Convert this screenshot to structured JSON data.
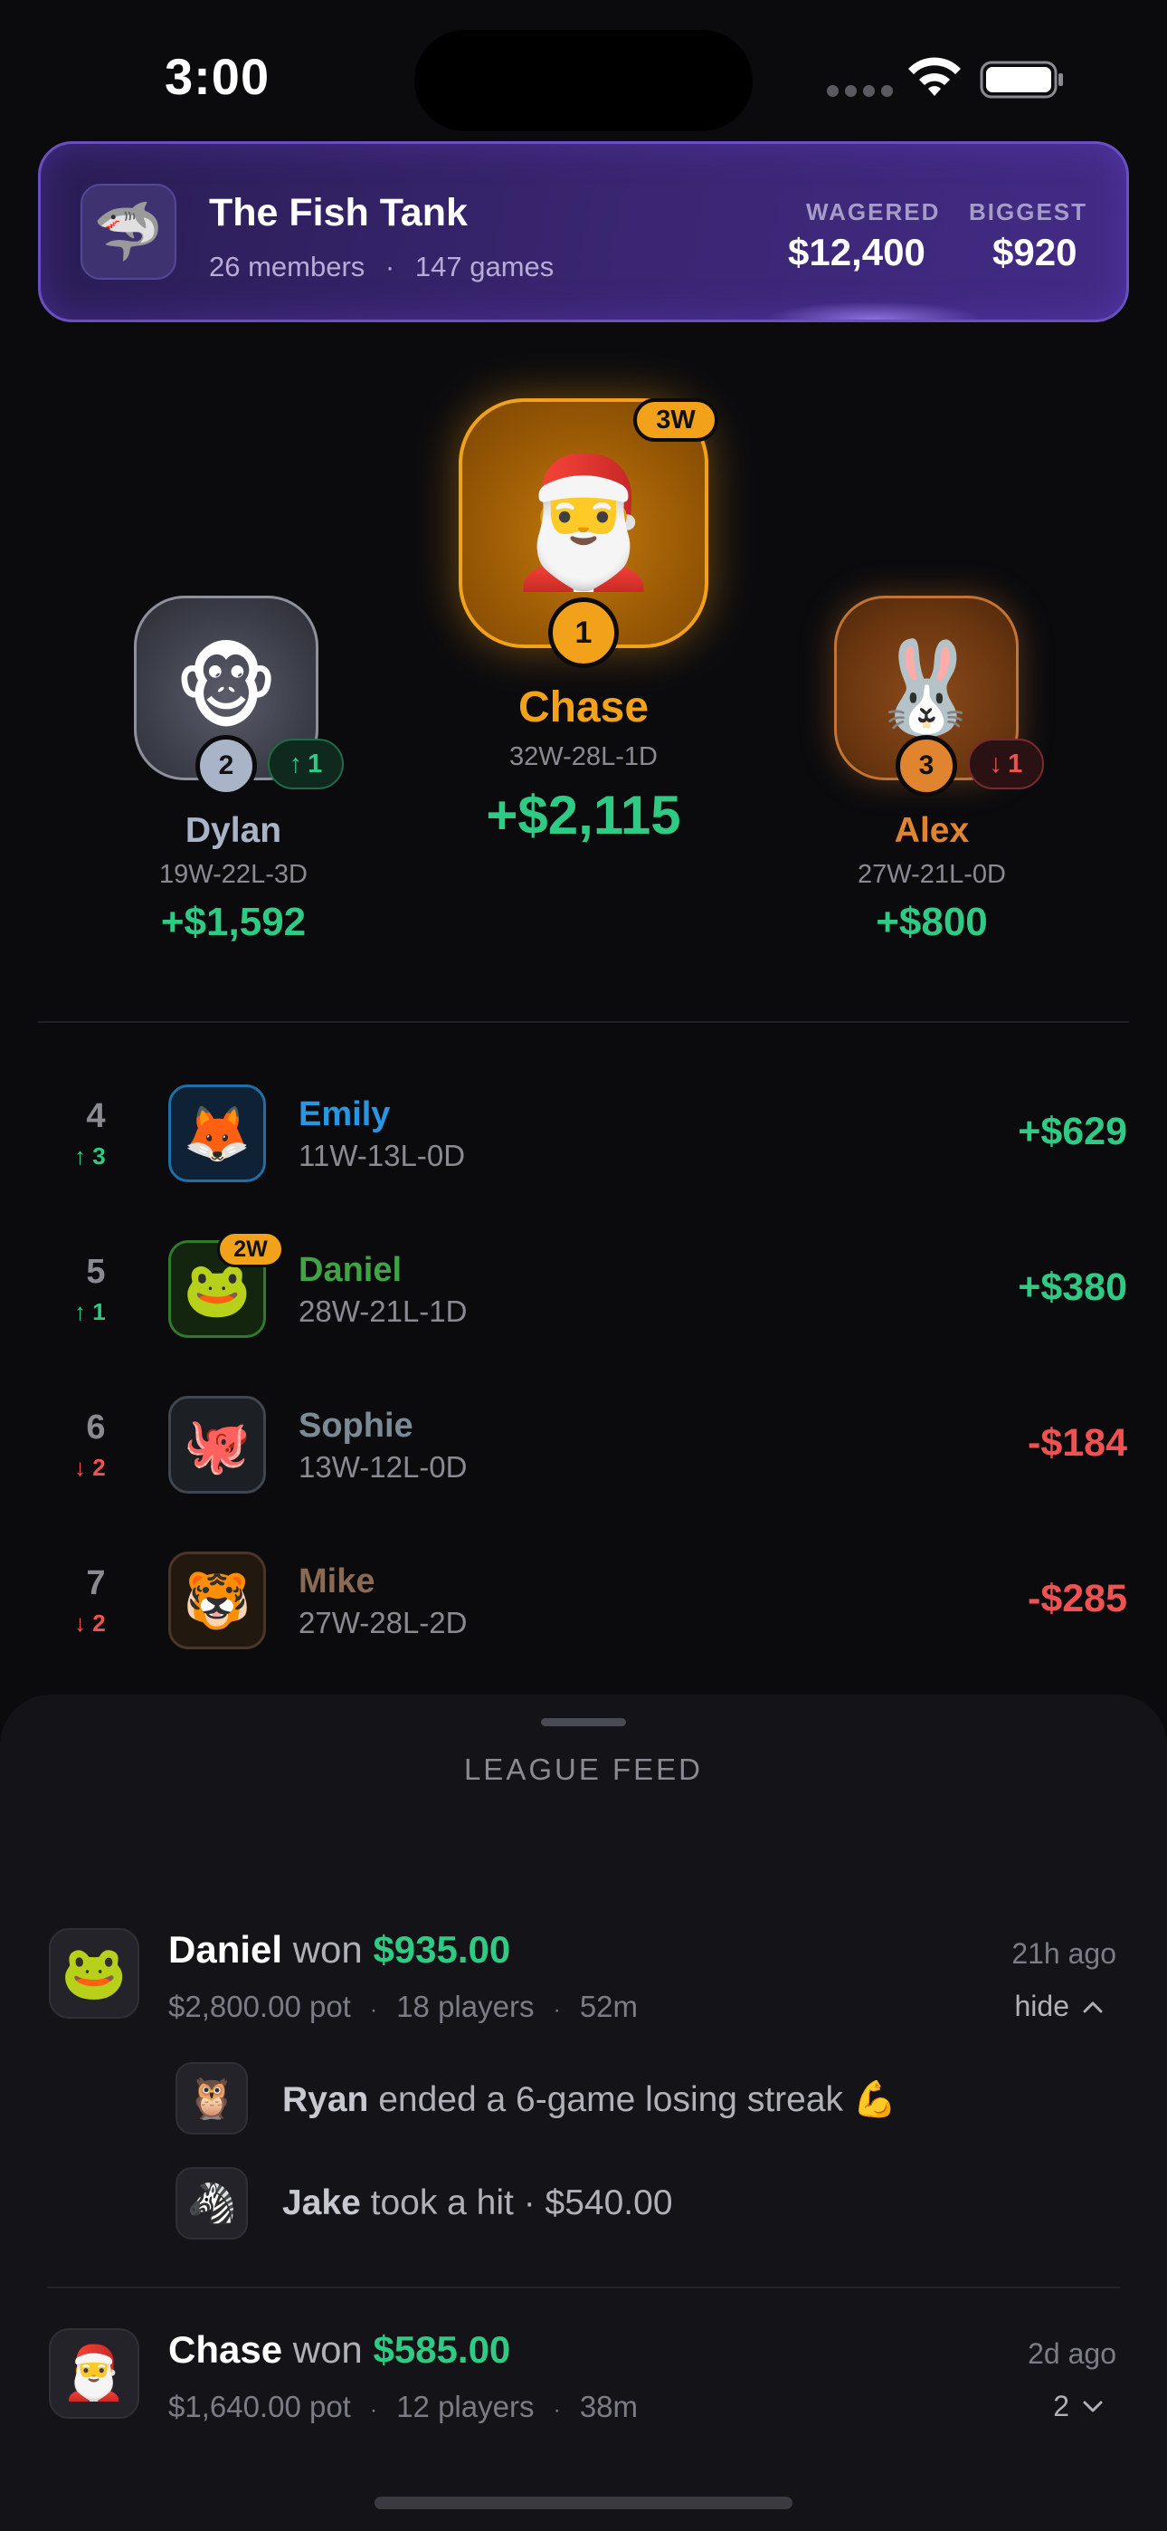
{
  "status": {
    "time": "3:00"
  },
  "league": {
    "logo": "🦈",
    "name": "The Fish Tank",
    "members": "26 members",
    "games": "147 games",
    "separator": "·",
    "wagered_label": "WAGERED",
    "wagered_value": "$12,400",
    "biggest_label": "BIGGEST",
    "biggest_value": "$920",
    "accent": "#6a4fc2"
  },
  "podium": {
    "first": {
      "avatar": "🎅",
      "rank": "1",
      "streak": "3W",
      "name": "Chase",
      "record": "32W-28L-1D",
      "amount": "+$2,115",
      "color": "#f2a21a"
    },
    "second": {
      "avatar": "🐵",
      "rank": "2",
      "move_arrow": "↑",
      "move": "1",
      "name": "Dylan",
      "record": "19W-22L-3D",
      "amount": "+$1,592",
      "color": "#a9b4c8"
    },
    "third": {
      "avatar": "🐰",
      "rank": "3",
      "move_arrow": "↓",
      "move": "1",
      "name": "Alex",
      "record": "27W-21L-0D",
      "amount": "+$800",
      "color": "#e0842f"
    }
  },
  "rankings": [
    {
      "rank": "4",
      "move_arrow": "↑",
      "move": "3",
      "avatar": "🦊",
      "name": "Emily",
      "record": "11W-13L-0D",
      "amount": "+$629"
    },
    {
      "rank": "5",
      "move_arrow": "↑",
      "move": "1",
      "avatar": "🐸",
      "streak": "2W",
      "name": "Daniel",
      "record": "28W-21L-1D",
      "amount": "+$380"
    },
    {
      "rank": "6",
      "move_arrow": "↓",
      "move": "2",
      "avatar": "🐙",
      "name": "Sophie",
      "record": "13W-12L-0D",
      "amount": "-$184"
    },
    {
      "rank": "7",
      "move_arrow": "↓",
      "move": "2",
      "avatar": "🐯",
      "name": "Mike",
      "record": "27W-28L-2D",
      "amount": "-$285"
    }
  ],
  "feed": {
    "title": "LEAGUE FEED",
    "items": [
      {
        "avatar": "🐸",
        "who": "Daniel",
        "verb": "won",
        "amount": "$935.00",
        "pot": "$2,800.00 pot",
        "players": "18 players",
        "duration": "52m",
        "time": "21h ago",
        "toggle": "hide",
        "subs": [
          {
            "avatar": "🦉",
            "who": "Ryan",
            "text": "ended a 6-game losing streak 💪"
          },
          {
            "avatar": "🦓",
            "who": "Jake",
            "text": "took a hit · $540.00"
          }
        ]
      },
      {
        "avatar": "🎅",
        "who": "Chase",
        "verb": "won",
        "amount": "$585.00",
        "pot": "$1,640.00 pot",
        "players": "12 players",
        "duration": "38m",
        "time": "2d ago",
        "toggle": "2"
      }
    ]
  },
  "colors": {
    "positive": "#2fca84",
    "negative": "#f05252",
    "gold": "#f2a21a"
  }
}
